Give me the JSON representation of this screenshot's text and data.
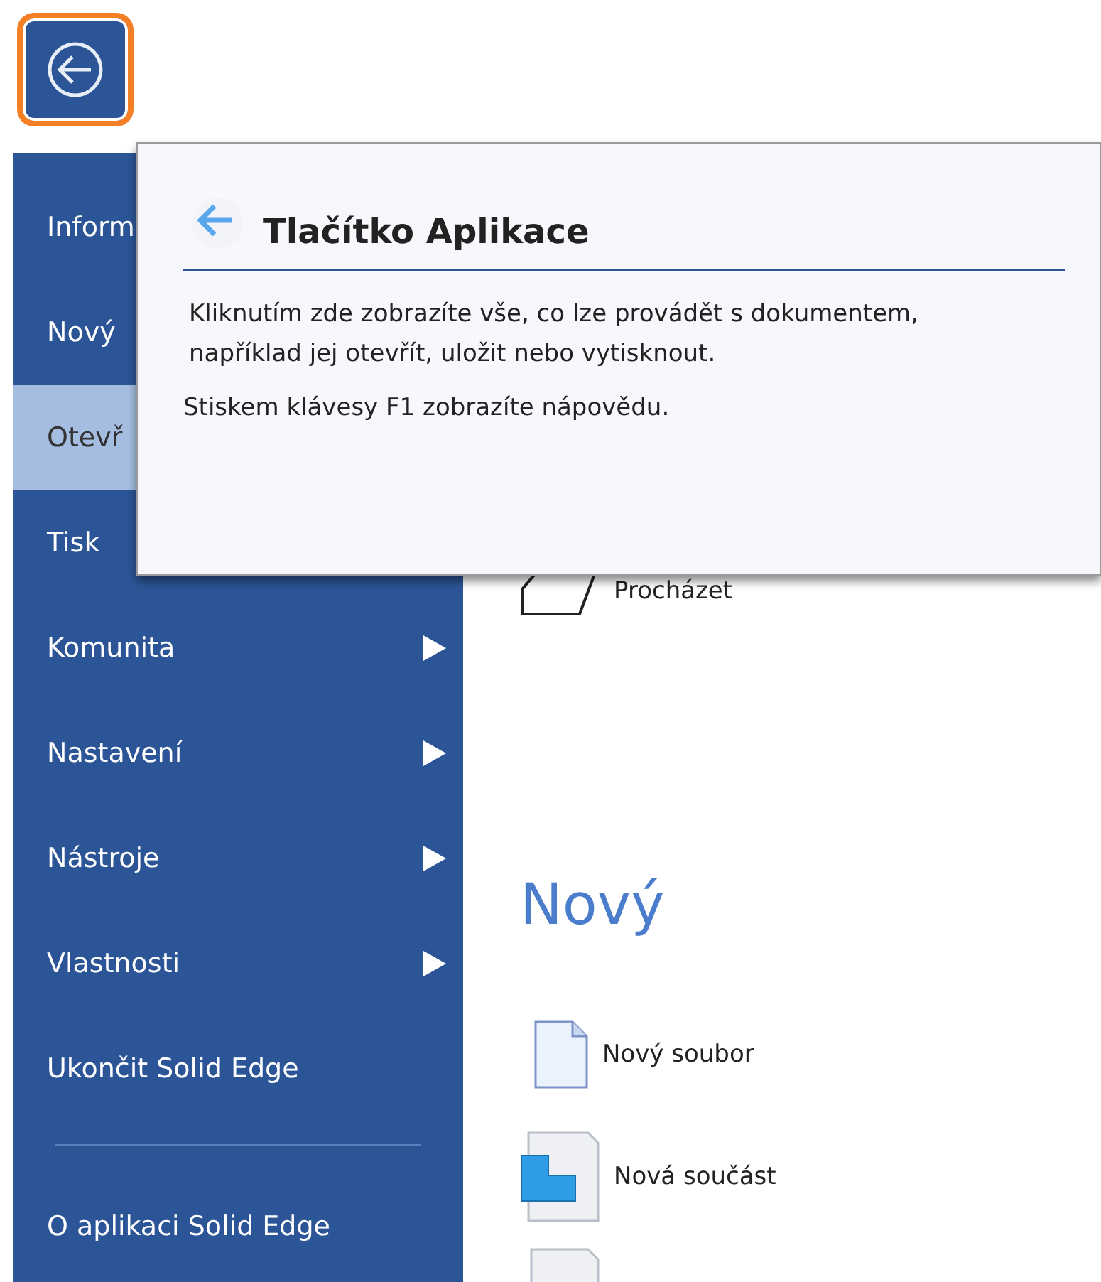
{
  "app_button": {
    "highlighted": true
  },
  "sidebar": {
    "items": [
      {
        "label": "Inform",
        "selected": false,
        "submenu": false
      },
      {
        "label": "Nový",
        "selected": false,
        "submenu": false
      },
      {
        "label": "Otevř",
        "selected": true,
        "submenu": false
      },
      {
        "label": "Tisk",
        "selected": false,
        "submenu": false
      },
      {
        "label": "Komunita",
        "selected": false,
        "submenu": true
      },
      {
        "label": "Nastavení",
        "selected": false,
        "submenu": true
      },
      {
        "label": "Nástroje",
        "selected": false,
        "submenu": true
      },
      {
        "label": "Vlastnosti",
        "selected": false,
        "submenu": true
      },
      {
        "label": "Ukončit Solid Edge",
        "selected": false,
        "submenu": false
      }
    ],
    "footer_items": [
      {
        "label": "O aplikaci Solid Edge",
        "selected": false,
        "submenu": false
      }
    ]
  },
  "content": {
    "browse": {
      "label": "Procházet"
    },
    "new_heading": "Nový",
    "new_items": [
      {
        "kind": "file",
        "label": "Nový soubor"
      },
      {
        "kind": "part",
        "label": "Nová součást"
      },
      {
        "kind": "blank"
      }
    ]
  },
  "tooltip": {
    "title": "Tlačítko Aplikace",
    "description": "Kliknutím zde zobrazíte vše, co lze provádět s dokumentem, například jej otevřít, uložit nebo vytisknout.",
    "help": "Stiskem klávesy F1 zobrazíte nápovědu."
  }
}
